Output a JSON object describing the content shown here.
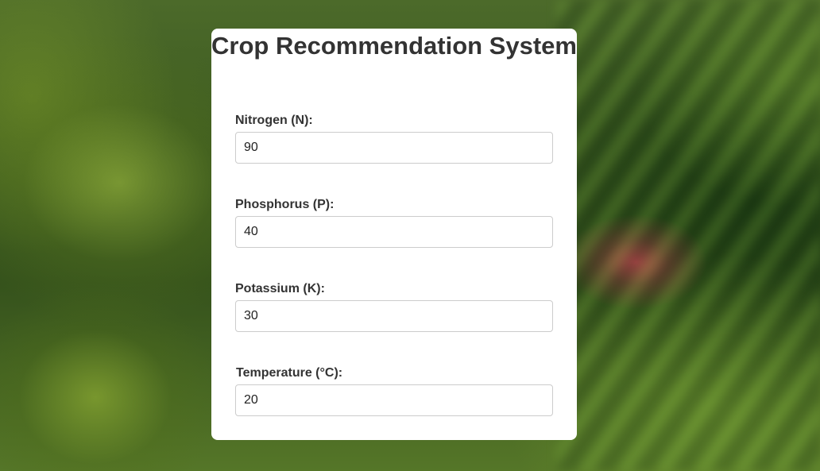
{
  "page": {
    "title": "Crop Recommendation System"
  },
  "fields": [
    {
      "label": "Nitrogen (N):",
      "value": "90"
    },
    {
      "label": "Phosphorus (P):",
      "value": "40"
    },
    {
      "label": "Potassium (K):",
      "value": "30"
    },
    {
      "label": "Temperature (°C):",
      "value": "20"
    }
  ],
  "colors": {
    "card_background": "#ffffff",
    "text": "#333333",
    "input_border": "#cccccc"
  }
}
